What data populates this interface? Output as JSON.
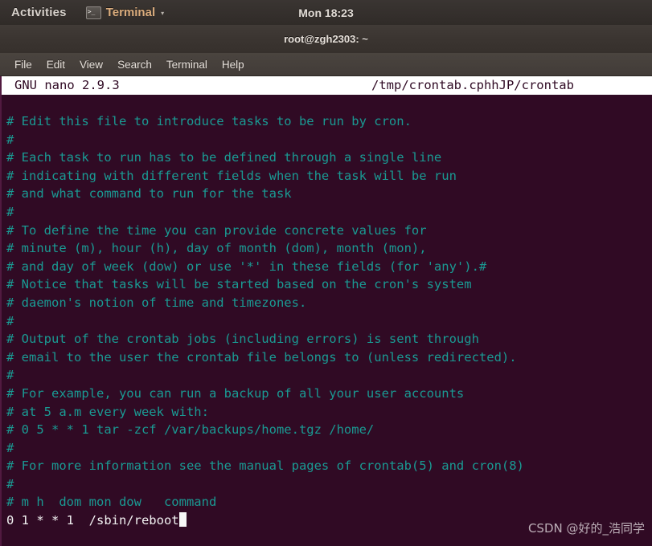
{
  "gnome_topbar": {
    "activities_label": "Activities",
    "app_menu_label": "Terminal",
    "app_menu_icon": "terminal-icon",
    "app_menu_arrow": "▾",
    "clock": "Mon 18:23"
  },
  "window": {
    "title": "root@zgh2303: ~"
  },
  "terminal_menubar": {
    "items": [
      {
        "label": "File"
      },
      {
        "label": "Edit"
      },
      {
        "label": "View"
      },
      {
        "label": "Search"
      },
      {
        "label": "Terminal"
      },
      {
        "label": "Help"
      }
    ]
  },
  "nano": {
    "version_label": "GNU nano 2.9.3",
    "filename": "/tmp/crontab.cphhJP/crontab",
    "lines": [
      {
        "text": "# Edit this file to introduce tasks to be run by cron.",
        "kind": "comment"
      },
      {
        "text": "#",
        "kind": "comment"
      },
      {
        "text": "# Each task to run has to be defined through a single line",
        "kind": "comment"
      },
      {
        "text": "# indicating with different fields when the task will be run",
        "kind": "comment"
      },
      {
        "text": "# and what command to run for the task",
        "kind": "comment"
      },
      {
        "text": "#",
        "kind": "comment"
      },
      {
        "text": "# To define the time you can provide concrete values for",
        "kind": "comment"
      },
      {
        "text": "# minute (m), hour (h), day of month (dom), month (mon),",
        "kind": "comment"
      },
      {
        "text": "# and day of week (dow) or use '*' in these fields (for 'any').#",
        "kind": "comment"
      },
      {
        "text": "# Notice that tasks will be started based on the cron's system",
        "kind": "comment"
      },
      {
        "text": "# daemon's notion of time and timezones.",
        "kind": "comment"
      },
      {
        "text": "#",
        "kind": "comment"
      },
      {
        "text": "# Output of the crontab jobs (including errors) is sent through",
        "kind": "comment"
      },
      {
        "text": "# email to the user the crontab file belongs to (unless redirected).",
        "kind": "comment"
      },
      {
        "text": "#",
        "kind": "comment"
      },
      {
        "text": "# For example, you can run a backup of all your user accounts",
        "kind": "comment"
      },
      {
        "text": "# at 5 a.m every week with:",
        "kind": "comment"
      },
      {
        "text": "# 0 5 * * 1 tar -zcf /var/backups/home.tgz /home/",
        "kind": "comment"
      },
      {
        "text": "#",
        "kind": "comment"
      },
      {
        "text": "# For more information see the manual pages of crontab(5) and cron(8)",
        "kind": "comment"
      },
      {
        "text": "#",
        "kind": "comment"
      },
      {
        "text": "# m h  dom mon dow   command",
        "kind": "comment"
      },
      {
        "text": "0 1 * * 1  /sbin/reboot",
        "kind": "code",
        "cursor_after": true
      }
    ]
  },
  "watermark": {
    "text": "CSDN @好的_浩同学"
  },
  "colors": {
    "terminal_background": "#300a24",
    "comment_text": "#1a9a93",
    "code_text": "#f2f2f2",
    "nano_bar_background": "#ffffff",
    "nano_bar_text": "#300a24",
    "topbar_background": "#302b28",
    "app_menu_accent": "#d9ab7c"
  }
}
